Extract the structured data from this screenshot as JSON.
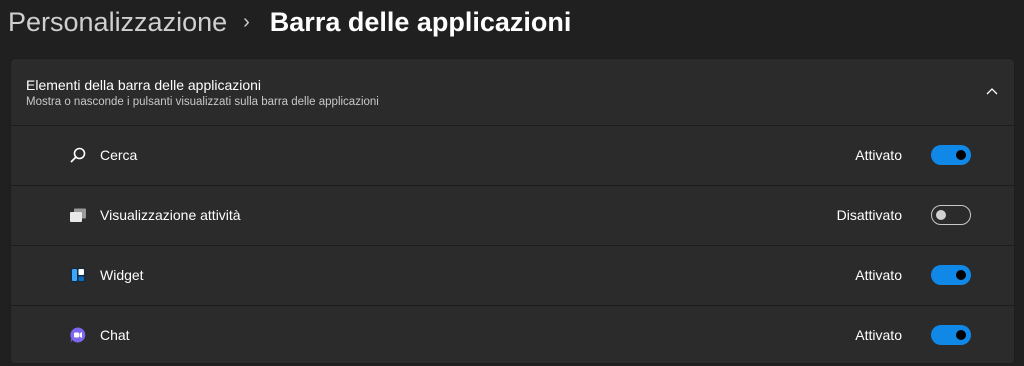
{
  "breadcrumb": {
    "parent": "Personalizzazione",
    "separator": "›",
    "current": "Barra delle applicazioni"
  },
  "section": {
    "title": "Elementi della barra delle applicazioni",
    "subtitle": "Mostra o nasconde i pulsanti visualizzati sulla barra delle applicazioni",
    "expanded": true,
    "collapse_icon": "chevron-up-icon"
  },
  "items": [
    {
      "label": "Cerca",
      "state": "Attivato",
      "on": true,
      "icon": "search-icon"
    },
    {
      "label": "Visualizzazione attività",
      "state": "Disattivato",
      "on": false,
      "icon": "task-view-icon"
    },
    {
      "label": "Widget",
      "state": "Attivato",
      "on": true,
      "icon": "widgets-icon"
    },
    {
      "label": "Chat",
      "state": "Attivato",
      "on": true,
      "icon": "chat-icon"
    }
  ],
  "colors": {
    "background": "#202020",
    "card": "#2b2b2b",
    "accent": "#0f88e8"
  }
}
